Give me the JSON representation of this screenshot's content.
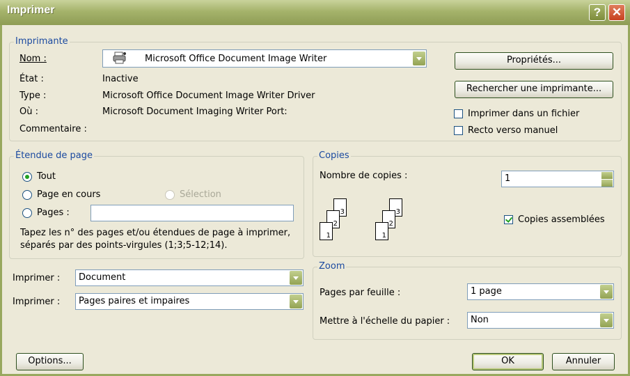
{
  "window": {
    "title": "Imprimer",
    "help": "?",
    "close": "✕"
  },
  "printer": {
    "legend": "Imprimante",
    "name_label": "Nom :",
    "name_value": "Microsoft Office Document Image Writer",
    "state_label": "État :",
    "state_value": "Inactive",
    "type_label": "Type :",
    "type_value": "Microsoft Office Document Image Writer Driver",
    "where_label": "Où :",
    "where_value": "Microsoft Document Imaging Writer Port:",
    "comment_label": "Commentaire :",
    "properties_button": "Propriétés...",
    "find_button": "Rechercher une imprimante...",
    "print_to_file": "Imprimer dans un fichier",
    "manual_duplex": "Recto verso manuel"
  },
  "range": {
    "legend": "Étendue de page",
    "all": "Tout",
    "current": "Page en cours",
    "selection": "Sélection",
    "pages": "Pages :",
    "pages_value": "",
    "help": "Tapez les n° des pages et/ou étendues de page à imprimer, séparés par des points-virgules (1;3;5-12;14)."
  },
  "copies": {
    "legend": "Copies",
    "count_label": "Nombre de copies :",
    "count_value": "1",
    "collate": "Copies assemblées",
    "page_numbers": [
      "1",
      "2",
      "3"
    ]
  },
  "print_what": {
    "label1": "Imprimer :",
    "value1": "Document",
    "label2": "Imprimer :",
    "value2": "Pages paires et impaires"
  },
  "zoom": {
    "legend": "Zoom",
    "pps_label": "Pages par feuille :",
    "pps_value": "1 page",
    "scale_label": "Mettre à l'échelle du papier :",
    "scale_value": "Non"
  },
  "buttons": {
    "options": "Options...",
    "ok": "OK",
    "cancel": "Annuler"
  }
}
